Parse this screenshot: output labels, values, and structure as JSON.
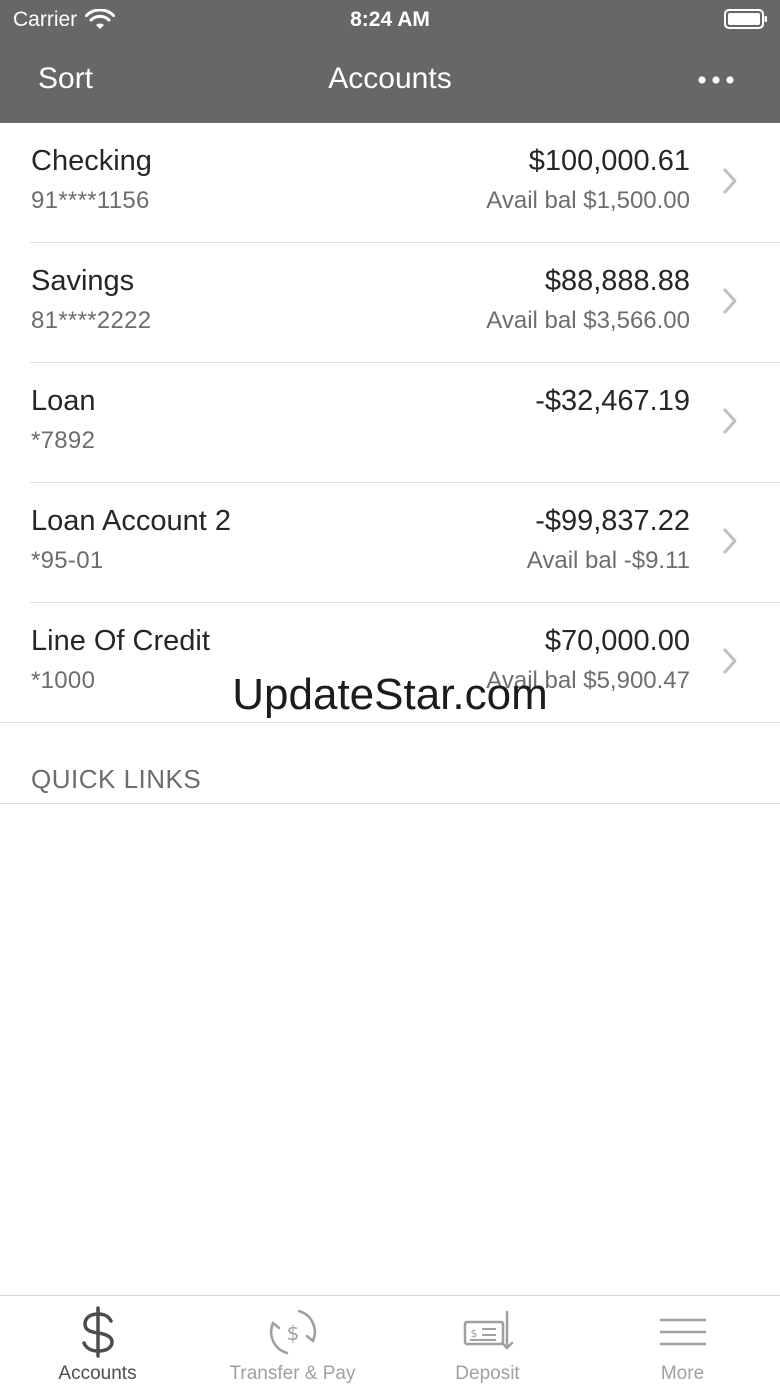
{
  "status_bar": {
    "carrier": "Carrier",
    "time": "8:24 AM"
  },
  "nav": {
    "left_label": "Sort",
    "title": "Accounts",
    "more_icon": "ellipsis-icon"
  },
  "accounts": [
    {
      "name": "Checking",
      "number": "91****1156",
      "balance": "$100,000.61",
      "available": "Avail bal $1,500.00"
    },
    {
      "name": "Savings",
      "number": "81****2222",
      "balance": "$88,888.88",
      "available": "Avail bal $3,566.00"
    },
    {
      "name": "Loan",
      "number": "*7892",
      "balance": "-$32,467.19",
      "available": ""
    },
    {
      "name": "Loan Account 2",
      "number": "*95-01",
      "balance": "-$99,837.22",
      "available": "Avail bal -$9.11"
    },
    {
      "name": "Line Of Credit",
      "number": "*1000",
      "balance": "$70,000.00",
      "available": "Avail bal $5,900.47"
    }
  ],
  "watermark": "UpdateStar.com",
  "quick_links": {
    "title": "QUICK LINKS"
  },
  "tabs": [
    {
      "label": "Accounts",
      "icon": "dollar-icon",
      "active": true
    },
    {
      "label": "Transfer & Pay",
      "icon": "transfer-icon",
      "active": false
    },
    {
      "label": "Deposit",
      "icon": "check-deposit-icon",
      "active": false
    },
    {
      "label": "More",
      "icon": "menu-icon",
      "active": false
    }
  ],
  "colors": {
    "header": "#676767",
    "text": "#262626",
    "secondary": "#6d6d6d",
    "divider": "#dcdcdc",
    "tab_inactive": "#a0a0a0",
    "tab_active": "#4d4d4d"
  }
}
